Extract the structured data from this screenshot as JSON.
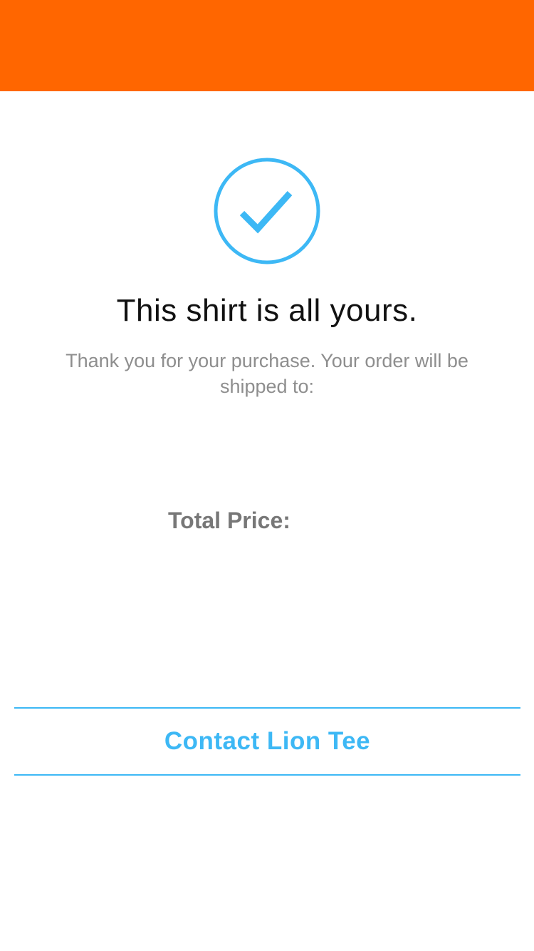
{
  "colors": {
    "header_bar": "#FF6600",
    "accent": "#3DB8F5"
  },
  "confirmation": {
    "icon": "checkmark-circle-icon",
    "headline": "This shirt is all yours.",
    "message": "Thank you for your purchase. Your order will be shipped to:",
    "total_label": "Total Price:"
  },
  "actions": {
    "contact_label": "Contact Lion Tee"
  }
}
